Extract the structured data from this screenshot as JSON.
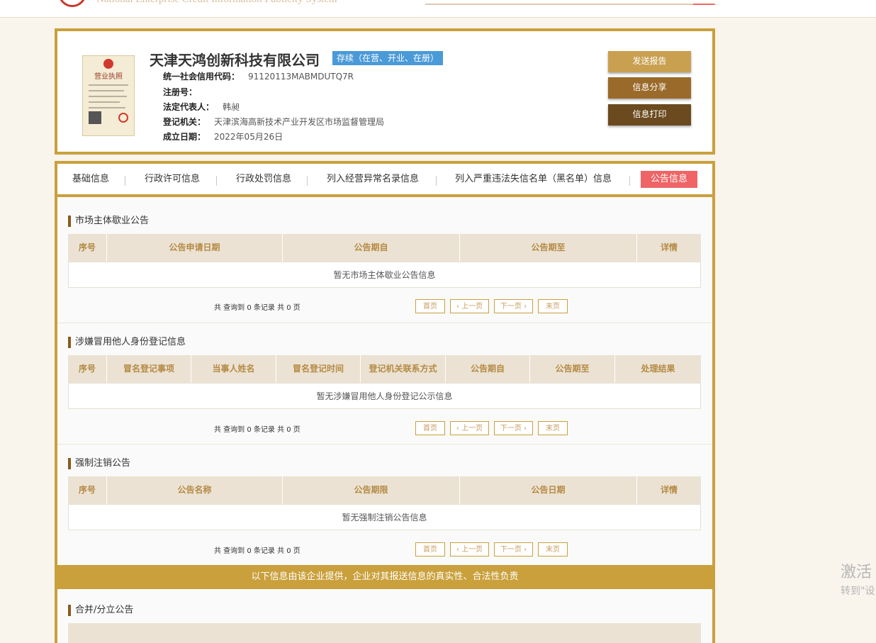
{
  "header": {
    "site_title_en": "National Enterprise Credit Information Publicity System"
  },
  "company": {
    "name": "天津天鸿创新科技有限公司",
    "status": "存续（在营、开业、在册）",
    "license_title": "营业执照",
    "fields": [
      {
        "label": "统一社会信用代码：",
        "value": "91120113MABMDUTQ7R"
      },
      {
        "label": "注册号：",
        "value": ""
      },
      {
        "label": "法定代表人：",
        "value": "韩昶"
      },
      {
        "label": "登记机关：",
        "value": "天津滨海高新技术产业开发区市场监督管理局"
      },
      {
        "label": "成立日期：",
        "value": "2022年05月26日"
      }
    ],
    "buttons": {
      "send_report": "发送报告",
      "share": "信息分享",
      "print": "信息打印"
    }
  },
  "tabs": [
    "基础信息",
    "行政许可信息",
    "行政处罚信息",
    "列入经营异常名录信息",
    "列入严重违法失信名单（黑名单）信息",
    "公告信息"
  ],
  "active_tab": "公告信息",
  "pager": {
    "count_text": "共 查询到 0 条记录 共 0 页",
    "first": "首页",
    "prev": "上一页",
    "next": "下一页",
    "last": "末页"
  },
  "sections": [
    {
      "title": "市场主体歇业公告",
      "columns": [
        "序号",
        "公告申请日期",
        "公告期自",
        "公告期至",
        "详情"
      ],
      "empty_text": "暂无市场主体歇业公告信息"
    },
    {
      "title": "涉嫌冒用他人身份登记信息",
      "columns": [
        "序号",
        "冒名登记事项",
        "当事人姓名",
        "冒名登记时间",
        "登记机关联系方式",
        "公告期自",
        "公告期至",
        "处理结果"
      ],
      "empty_text": "暂无涉嫌冒用他人身份登记公示信息"
    },
    {
      "title": "强制注销公告",
      "columns": [
        "序号",
        "公告名称",
        "公告期限",
        "公告日期",
        "详情"
      ],
      "empty_text": "暂无强制注销公告信息"
    },
    {
      "title": "合并/分立公告",
      "columns": [],
      "empty_text": ""
    }
  ],
  "banner": "以下信息由该企业提供，企业对其报送信息的真实性、合法性负责",
  "watermark": {
    "line1": "激活",
    "line2": "转到\"设"
  },
  "colors": {
    "gold": "#c9a03c",
    "tab_active": "#ef6466",
    "status_badge": "#4a9ad8",
    "btn_send": "#c9a050",
    "btn_share": "#9a6a2a",
    "btn_print": "#6a4a1e"
  }
}
